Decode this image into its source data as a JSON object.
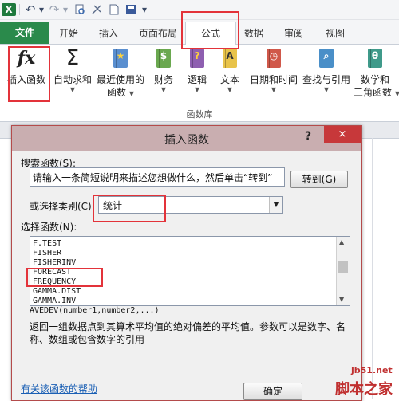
{
  "quick_access": {
    "excel_icon": "X",
    "undo_icon": "↶",
    "redo_icon": "↷",
    "dropdown_icon": "▾"
  },
  "tabs": {
    "file": "文件",
    "home": "开始",
    "insert": "插入",
    "page_layout": "页面布局",
    "formulas": "公式",
    "data": "数据",
    "review": "审阅",
    "view": "视图"
  },
  "ribbon": {
    "insert_function": "插入函数",
    "autosum": "自动求和",
    "recently_used_line1": "最近使用的",
    "recently_used_line2": "函数",
    "financial": "财务",
    "logical": "逻辑",
    "text": "文本",
    "date_time": "日期和时间",
    "lookup": "查找与引用",
    "math_line1": "数学和",
    "math_line2": "三角函数",
    "group_label": "函数库",
    "fx_symbol": "fx",
    "sigma_symbol": "Σ",
    "theta_symbol": "θ",
    "logical_symbol": "?",
    "text_symbol": "A"
  },
  "dialog": {
    "title": "插入函数",
    "help_mark": "?",
    "close_mark": "×",
    "search_label": "搜索函数(S):",
    "search_value": "请输入一条简短说明来描述您想做什么，然后单击“转到”",
    "go_button": "转到(G)",
    "category_label": "或选择类别(C)",
    "category_value": "统计",
    "select_label": "选择函数(N):",
    "functions": [
      "F.TEST",
      "FISHER",
      "FISHERINV",
      "FORECAST",
      "FREQUENCY",
      "GAMMA.DIST",
      "GAMMA.INV"
    ],
    "signature": "AVEDEV(number1,number2,...)",
    "description": "返回一组数据点到其算术平均值的绝对偏差的平均值。参数可以是数字、名称、数组或包含数字的引用",
    "help_link": "有关该函数的帮助",
    "ok_button": "确定"
  },
  "watermark": {
    "site": "jb51.net",
    "brand": "脚本之家"
  },
  "colors": {
    "file_tab": "#2a8a4b",
    "highlight": "#e3333a",
    "dialog_title": "#c9aeb0",
    "close_button": "#c7383a"
  }
}
